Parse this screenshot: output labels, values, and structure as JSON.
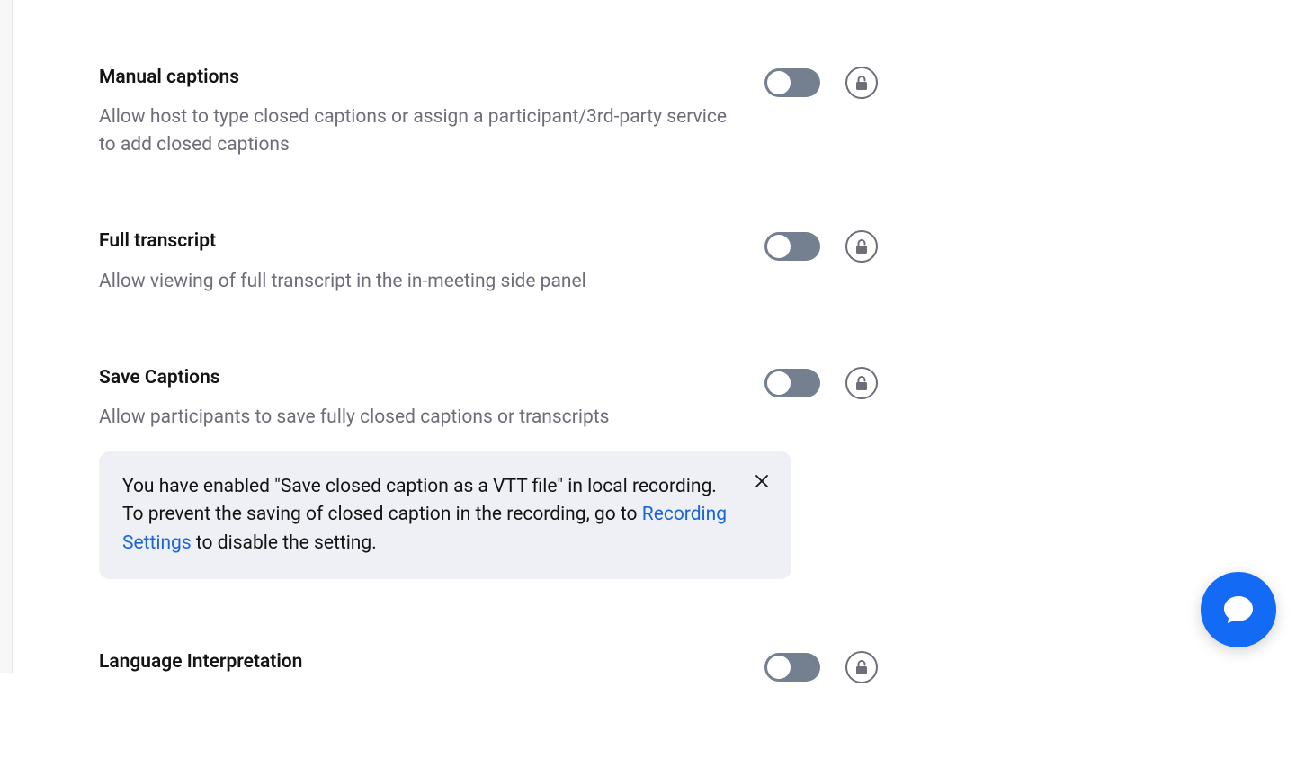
{
  "settings": [
    {
      "title": "Manual captions",
      "desc": "Allow host to type closed captions or assign a participant/3rd-party service to add closed captions"
    },
    {
      "title": "Full transcript",
      "desc": "Allow viewing of full transcript in the in-meeting side panel"
    },
    {
      "title": "Save Captions",
      "desc": "Allow participants to save fully closed captions or transcripts"
    },
    {
      "title": "Language Interpretation",
      "desc": ""
    }
  ],
  "banner": {
    "text_before": "You have enabled \"Save closed caption as a VTT file\" in local recording. To prevent the saving of closed caption in the recording, go to ",
    "link": "Recording Settings",
    "text_after": " to disable the setting."
  }
}
